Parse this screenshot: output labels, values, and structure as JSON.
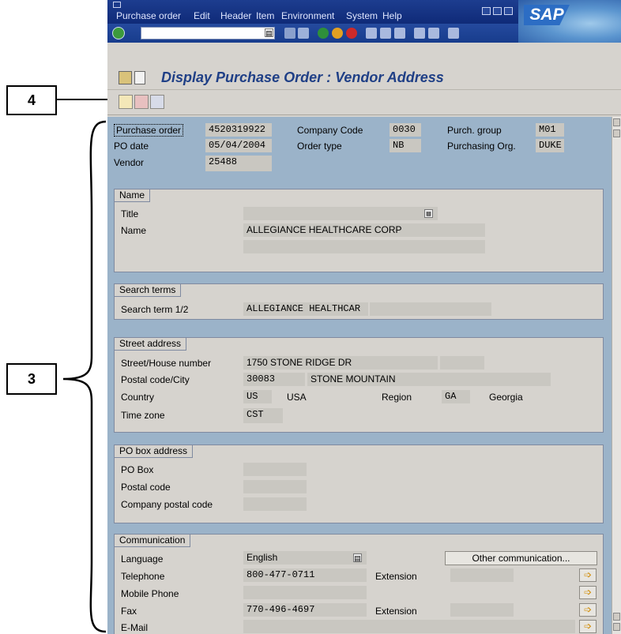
{
  "callouts": {
    "four": "4",
    "three": "3"
  },
  "menu": [
    "Purchase order",
    "Edit",
    "Header",
    "Item",
    "Environment",
    "System",
    "Help"
  ],
  "brand": "SAP",
  "title": "Display Purchase Order : Vendor Address",
  "header": {
    "po_label": "Purchase order",
    "po_value": "4520319922",
    "company_code_label": "Company Code",
    "company_code_value": "0030",
    "purch_group_label": "Purch. group",
    "purch_group_value": "M01",
    "po_date_label": "PO date",
    "po_date_value": "05/04/2004",
    "order_type_label": "Order type",
    "order_type_value": "NB",
    "purch_org_label": "Purchasing Org.",
    "purch_org_value": "DUKE",
    "vendor_label": "Vendor",
    "vendor_value": "25488"
  },
  "name_group": {
    "tab": "Name",
    "title_label": "Title",
    "name_label": "Name",
    "name_value": "ALLEGIANCE HEALTHCARE CORP"
  },
  "search_group": {
    "tab": "Search terms",
    "label": "Search term 1/2",
    "value": "ALLEGIANCE HEALTHCAR"
  },
  "street_group": {
    "tab": "Street address",
    "street_label": "Street/House number",
    "street_value": "1750 STONE RIDGE DR",
    "postal_label": "Postal code/City",
    "postal_value": "30083",
    "city_value": "STONE MOUNTAIN",
    "country_label": "Country",
    "country_code": "US",
    "country_name": "USA",
    "region_label": "Region",
    "region_code": "GA",
    "region_name": "Georgia",
    "tz_label": "Time zone",
    "tz_value": "CST"
  },
  "pobox_group": {
    "tab": "PO box address",
    "pobox_label": "PO Box",
    "postal_label": "Postal code",
    "company_postal_label": "Company postal code"
  },
  "comm_group": {
    "tab": "Communication",
    "language_label": "Language",
    "language_value": "English",
    "other_button": "Other communication...",
    "tel_label": "Telephone",
    "tel_value": "800-477-0711",
    "tel_ext_label": "Extension",
    "mobile_label": "Mobile Phone",
    "fax_label": "Fax",
    "fax_value": "770-496-4697",
    "fax_ext_label": "Extension",
    "email_label": "E-Mail"
  },
  "colors": {
    "menubar": "#1d3d8f",
    "content_bg": "#9bb3c9",
    "panel_bg": "#d6d3ce",
    "title_text": "#1f3f86"
  }
}
